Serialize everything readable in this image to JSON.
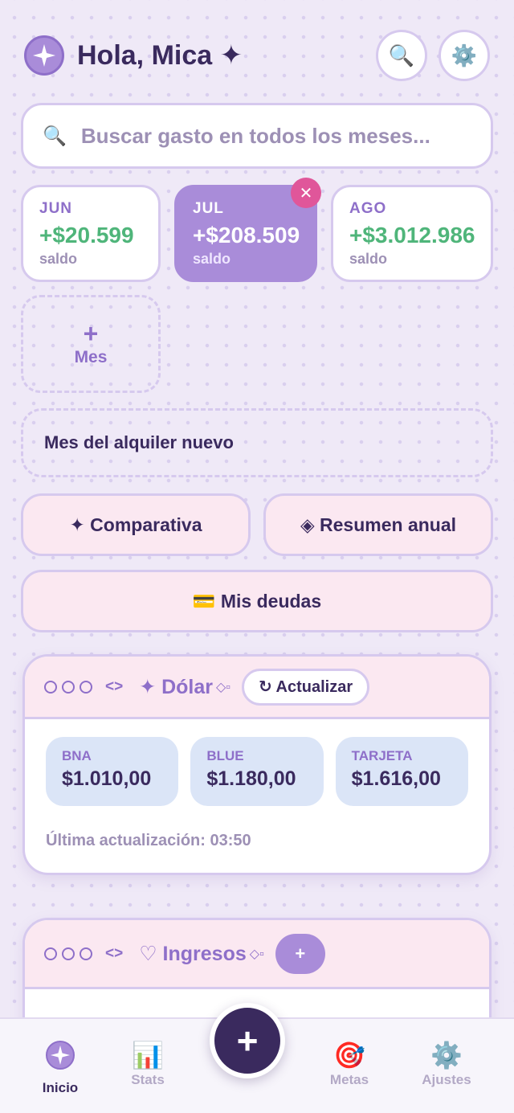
{
  "header": {
    "greeting": "Hola, Mica ✦",
    "search_icon": "🔍",
    "settings_icon": "⚙️"
  },
  "search": {
    "placeholder": "Buscar gasto en todos los meses...",
    "icon": "🔍"
  },
  "months": [
    {
      "name": "JUN",
      "amount": "+$20.599",
      "sub": "saldo"
    },
    {
      "name": "JUL",
      "amount": "+$208.509",
      "sub": "saldo",
      "active": true
    },
    {
      "name": "AGO",
      "amount": "+$3.012.986",
      "sub": "saldo"
    }
  ],
  "add_month": {
    "plus": "+",
    "label": "Mes"
  },
  "close_badge": "✕",
  "note": "Mes del alquiler nuevo",
  "actions": {
    "comparativa": "✦ Comparativa",
    "resumen": "◈ Resumen anual",
    "deudas": "💳 Mis deudas"
  },
  "dolar_card": {
    "code": "<>",
    "title": "✦ Dólar",
    "diamond": "◇▫",
    "refresh": "↻ Actualizar",
    "rates": [
      {
        "name": "BNA",
        "value": "$1.010,00"
      },
      {
        "name": "BLUE",
        "value": "$1.180,00"
      },
      {
        "name": "TARJETA",
        "value": "$1.616,00"
      }
    ],
    "updated": "Última actualización: 03:50"
  },
  "ingresos_card": {
    "code": "<>",
    "title": "♡ Ingresos",
    "diamond": "◇▫",
    "add": "+"
  },
  "nav": {
    "inicio": "Inicio",
    "stats": "Stats",
    "stats_icon": "📊",
    "fab": "+",
    "metas": "Metas",
    "metas_icon": "🎯",
    "ajustes": "Ajustes",
    "ajustes_icon": "⚙️"
  },
  "colors": {
    "accent": "#a98cd9",
    "dark": "#3a2a5e",
    "positive": "#4fb57a",
    "badge": "#e0569a",
    "pink": "#fbe8f1",
    "rate_bg": "#dbe5f7"
  }
}
